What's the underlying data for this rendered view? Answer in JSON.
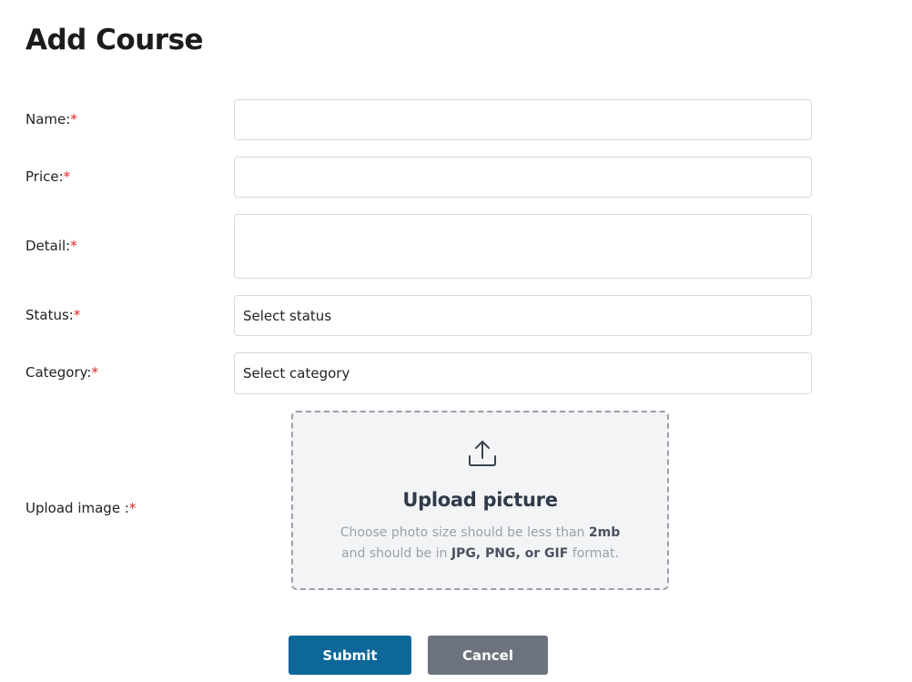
{
  "page": {
    "title": "Add Course"
  },
  "form": {
    "required_marker": "*",
    "name": {
      "label": "Name:",
      "value": ""
    },
    "price": {
      "label": "Price:",
      "value": ""
    },
    "detail": {
      "label": "Detail:",
      "value": ""
    },
    "status": {
      "label": "Status:",
      "selected": "Select status"
    },
    "category": {
      "label": "Category:",
      "selected": "Select category"
    },
    "upload": {
      "label": "Upload image :",
      "title": "Upload picture",
      "hint_line1_prefix": "Choose photo size should be less than",
      "hint_size": "2mb",
      "hint_line2_prefix": "and should be in",
      "hint_formats": "JPG, PNG, or GIF",
      "hint_line2_suffix": "format.",
      "icon": "upload-icon"
    }
  },
  "actions": {
    "submit_label": "Submit",
    "cancel_label": "Cancel"
  },
  "colors": {
    "required": "#e02424",
    "submit_bg": "#0d6799",
    "cancel_bg": "#6c737f",
    "upload_bg": "#f3f4f6"
  }
}
